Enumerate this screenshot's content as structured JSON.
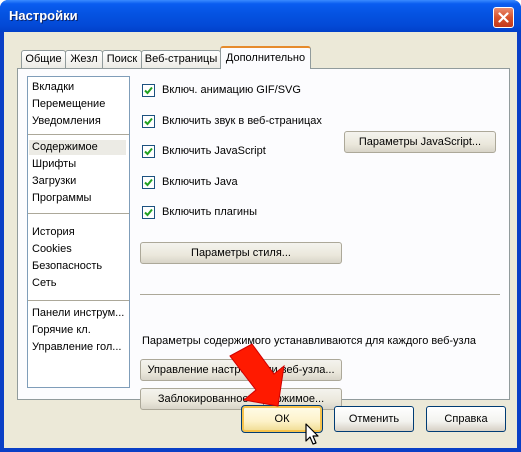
{
  "window": {
    "title": "Настройки"
  },
  "tabs": [
    {
      "label": "Общие",
      "active": false
    },
    {
      "label": "Жезл",
      "active": false
    },
    {
      "label": "Поиск",
      "active": false
    },
    {
      "label": "Веб-страницы",
      "active": false
    },
    {
      "label": "Дополнительно",
      "active": true
    }
  ],
  "sidebar": {
    "groups": [
      [
        "Вкладки",
        "Перемещение",
        "Уведомления"
      ],
      [
        "Содержимое",
        "Шрифты",
        "Загрузки",
        "Программы"
      ],
      [
        "История",
        "Cookies",
        "Безопасность",
        "Сеть"
      ],
      [
        "Панели инструм...",
        "Горячие кл.",
        "Управление гол..."
      ]
    ],
    "selected": "Содержимое"
  },
  "options": [
    {
      "label": "Включ. анимацию GIF/SVG",
      "checked": true
    },
    {
      "label": "Включить звук в веб-страницах",
      "checked": true
    },
    {
      "label": "Включить JavaScript",
      "checked": true
    },
    {
      "label": "Включить Java",
      "checked": true
    },
    {
      "label": "Включить плагины",
      "checked": true
    }
  ],
  "buttons": {
    "js_settings": "Параметры JavaScript...",
    "style_settings": "Параметры стиля...",
    "site_settings": "Управление настройками веб-узла...",
    "blocked_content": "Заблокированное содержимое...",
    "ok": "ОК",
    "cancel": "Отменить",
    "help": "Справка"
  },
  "info_text": "Параметры содержимого устанавливаются для каждого веб-узла",
  "colors": {
    "titlebar": "#0554e3",
    "close_button": "#d7532c",
    "window_face": "#ece9d8",
    "annotation_arrow": "#ff0000"
  },
  "icons": [
    "close-icon",
    "checkmark-icon",
    "red-arrow-annotation",
    "mouse-cursor-icon"
  ]
}
